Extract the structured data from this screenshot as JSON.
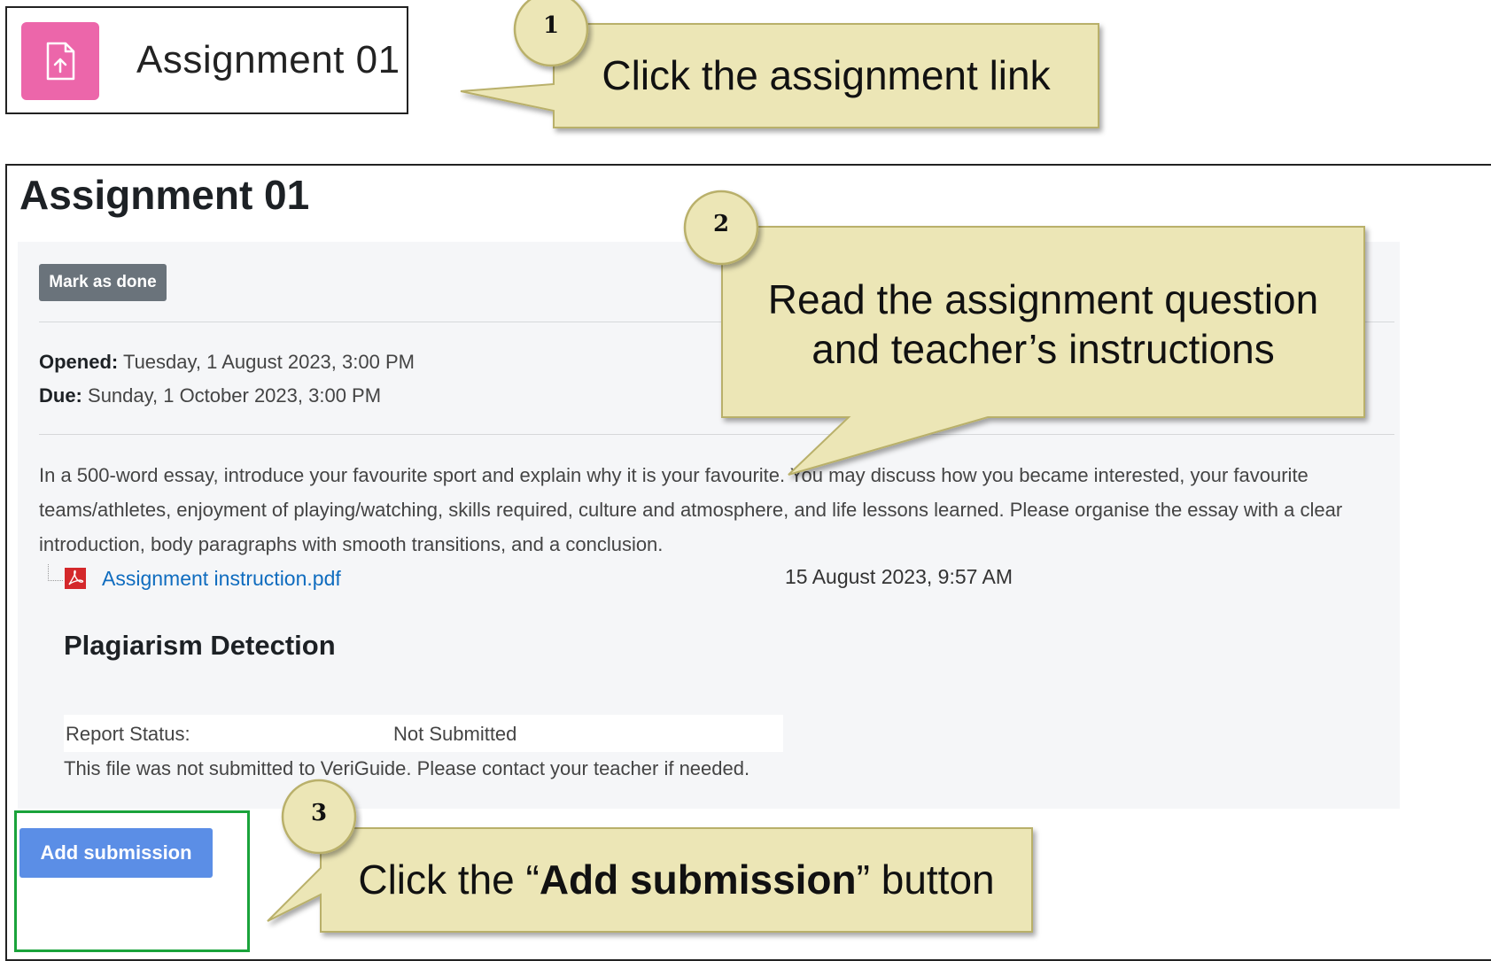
{
  "link_card": {
    "title": "Assignment 01",
    "icon": "file-upload-icon",
    "icon_bg": "#ec66aa"
  },
  "page": {
    "title": "Assignment 01",
    "mark_done_label": "Mark as done",
    "opened_label": "Opened:",
    "opened_value": "Tuesday, 1 August 2023, 3:00 PM",
    "due_label": "Due:",
    "due_value": "Sunday, 1 October 2023, 3:00 PM",
    "description": "In a 500-word essay, introduce your favourite sport and explain why it is your favourite. You may discuss how you became interested, your favourite teams/athletes, enjoyment of playing/watching, skills required, culture and atmosphere, and life lessons learned. Please organise the essay with a clear introduction, body paragraphs with smooth transitions, and a conclusion.",
    "attachment": {
      "name": "Assignment instruction.pdf",
      "date": "15 August 2023, 9:57 AM",
      "icon": "pdf-icon"
    },
    "plagiarism": {
      "title": "Plagiarism Detection",
      "report_status_label": "Report Status:",
      "report_status_value": "Not Submitted",
      "note": "This file was not submitted to VeriGuide. Please contact your teacher if needed."
    },
    "add_submission_label": "Add submission"
  },
  "callouts": [
    {
      "number": "1",
      "text": "Click the assignment link"
    },
    {
      "number": "2",
      "line1": "Read the assignment question",
      "line2": "and teacher’s instructions"
    },
    {
      "number": "3",
      "prefix": "Click the “",
      "bold": "Add submission",
      "suffix": "” button"
    }
  ],
  "colors": {
    "callout_fill": "#ece6b6",
    "callout_border": "#b9b06a",
    "accent_link": "#0f6cbf",
    "button_primary": "#5b8ee6",
    "highlight": "#1aa33b"
  }
}
